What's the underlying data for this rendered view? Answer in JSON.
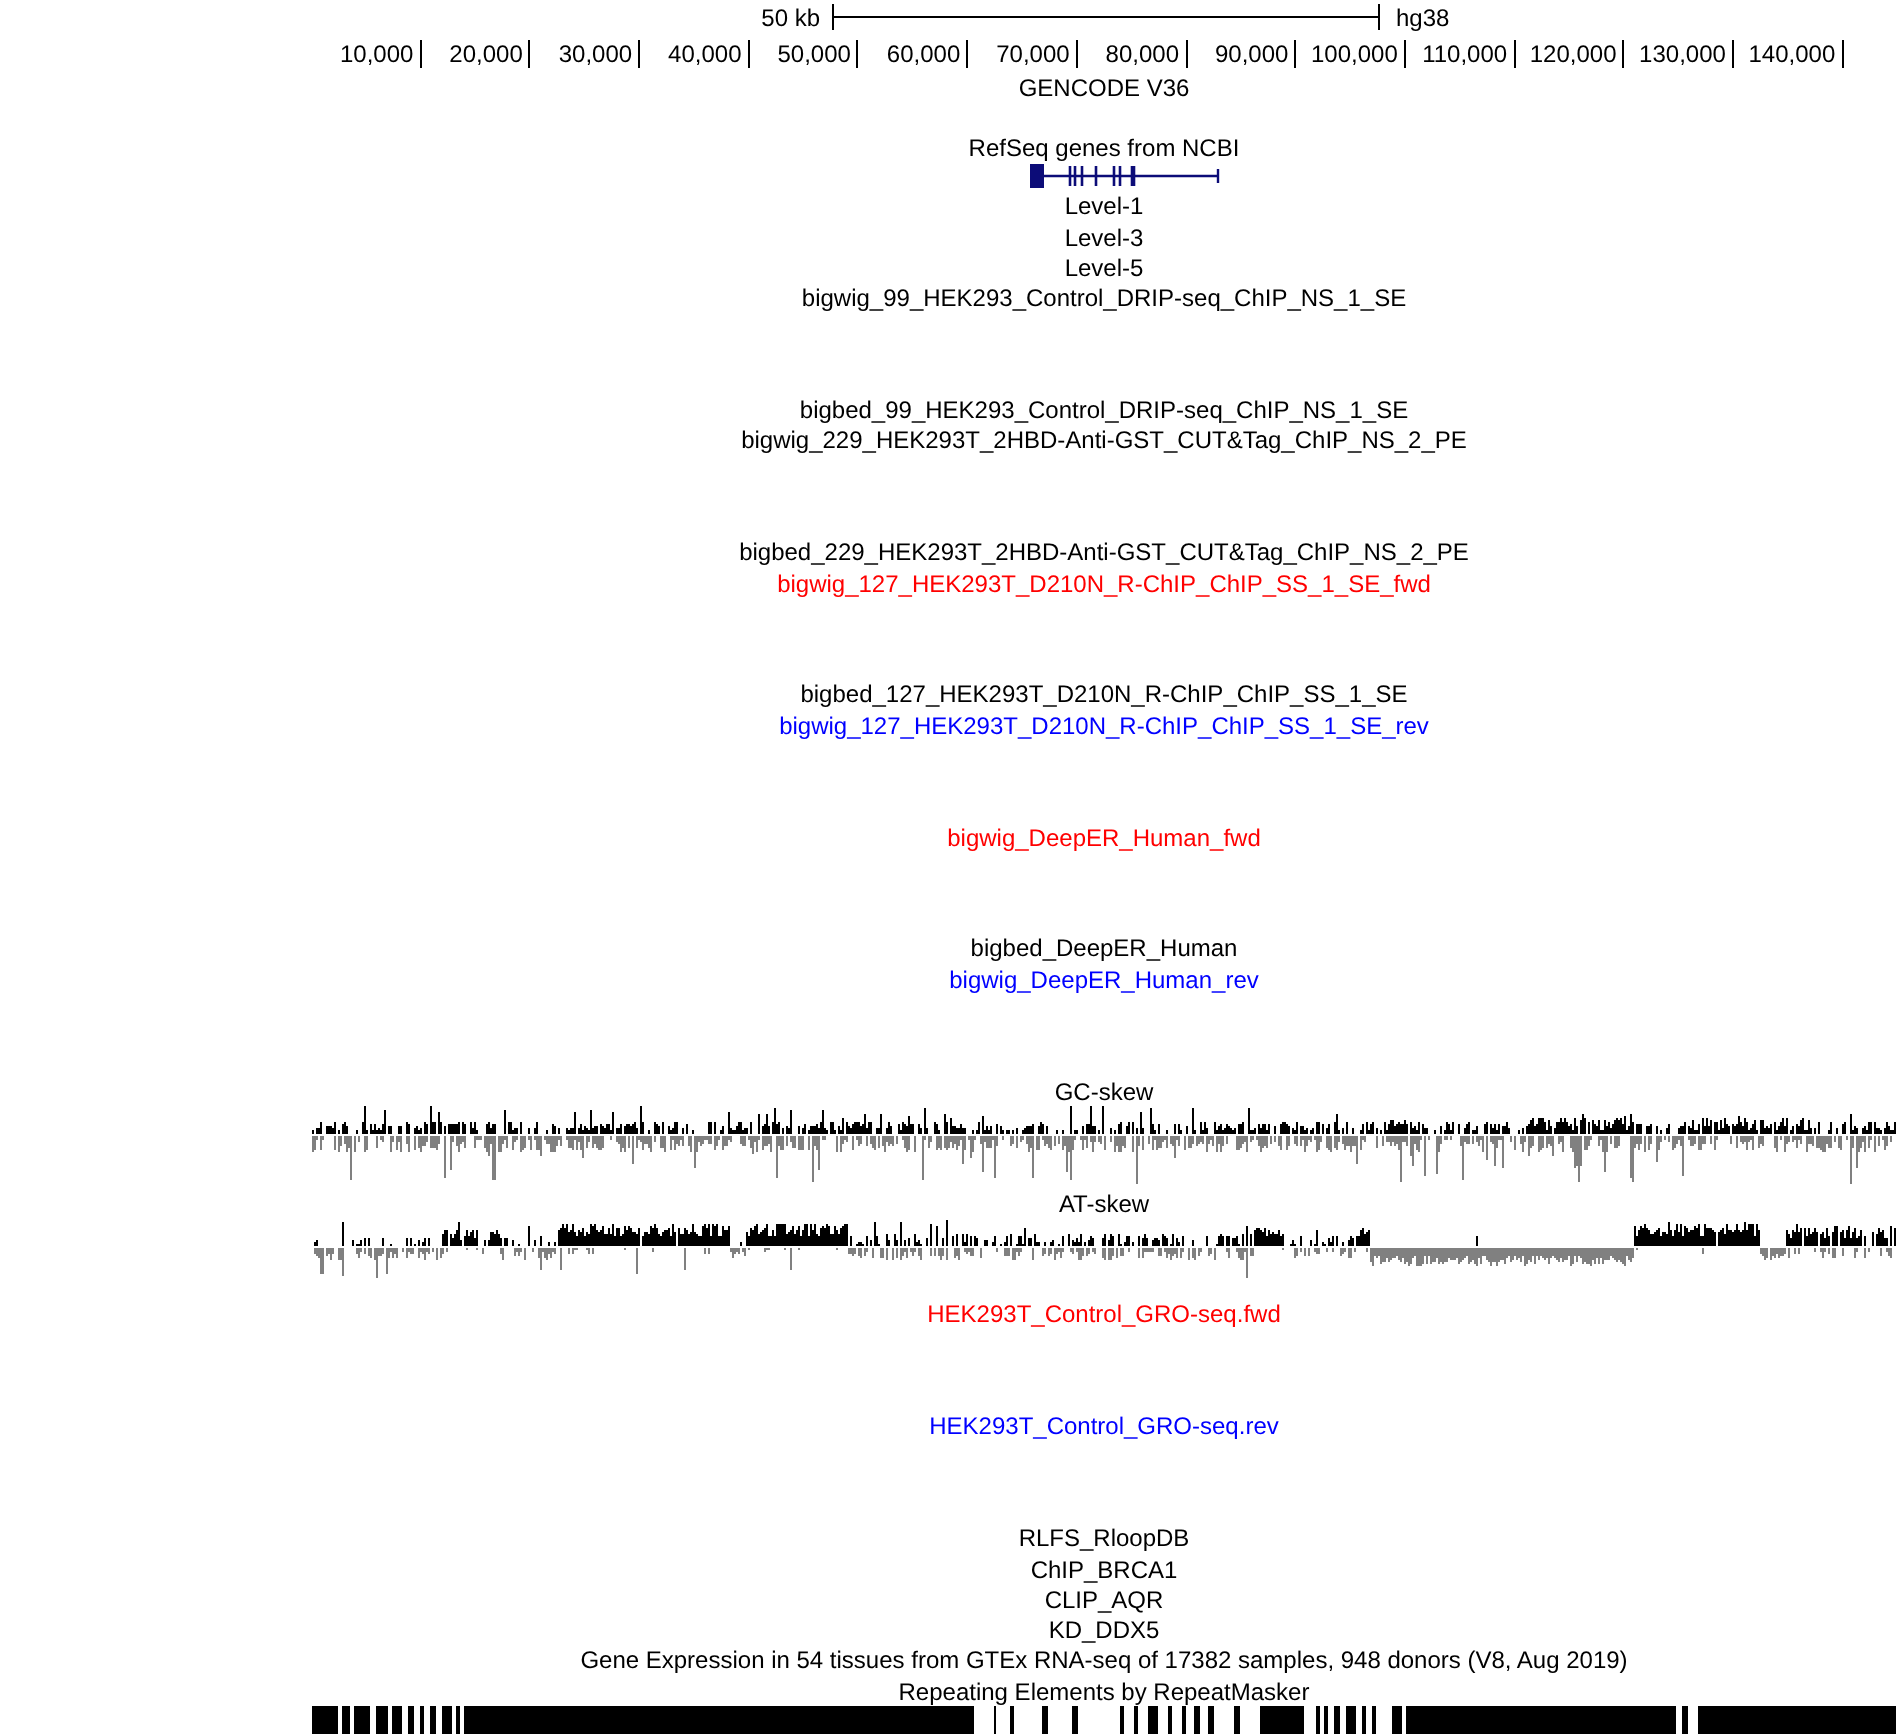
{
  "scale_bar": {
    "label": "50 kb",
    "assembly": "hg38"
  },
  "ruler": {
    "ticks": [
      "10,000",
      "20,000",
      "30,000",
      "40,000",
      "50,000",
      "60,000",
      "70,000",
      "80,000",
      "90,000",
      "100,000",
      "110,000",
      "120,000",
      "130,000",
      "140,000"
    ]
  },
  "tracks": [
    {
      "kind": "blank",
      "label": "GENCODE V36",
      "color": "#000000"
    },
    {
      "kind": "gene",
      "label": "RefSeq genes from NCBI",
      "color": "#000000"
    },
    {
      "kind": "label",
      "label": "Level-1",
      "color": "#000000"
    },
    {
      "kind": "label",
      "label": "Level-3",
      "color": "#000000"
    },
    {
      "kind": "label",
      "label": "Level-5",
      "color": "#000000"
    },
    {
      "kind": "signal",
      "label": "bigwig_99_HEK293_Control_DRIP-seq_ChIP_NS_1_SE",
      "color": "#000000"
    },
    {
      "kind": "label",
      "label": "bigbed_99_HEK293_Control_DRIP-seq_ChIP_NS_1_SE",
      "color": "#000000"
    },
    {
      "kind": "signal",
      "label": "bigwig_229_HEK293T_2HBD-Anti-GST_CUT&Tag_ChIP_NS_2_PE",
      "color": "#000000"
    },
    {
      "kind": "label",
      "label": "bigbed_229_HEK293T_2HBD-Anti-GST_CUT&Tag_ChIP_NS_2_PE",
      "color": "#000000"
    },
    {
      "kind": "signal",
      "label": "bigwig_127_HEK293T_D210N_R-ChIP_ChIP_SS_1_SE_fwd",
      "color": "#ff0000"
    },
    {
      "kind": "label",
      "label": "bigbed_127_HEK293T_D210N_R-ChIP_ChIP_SS_1_SE",
      "color": "#000000"
    },
    {
      "kind": "signal",
      "label": "bigwig_127_HEK293T_D210N_R-ChIP_ChIP_SS_1_SE_rev",
      "color": "#0000ff"
    },
    {
      "kind": "signal",
      "label": "bigwig_DeepER_Human_fwd",
      "color": "#ff0000"
    },
    {
      "kind": "label",
      "label": "bigbed_DeepER_Human",
      "color": "#000000"
    },
    {
      "kind": "signal",
      "label": "bigwig_DeepER_Human_rev",
      "color": "#0000ff"
    },
    {
      "kind": "skew",
      "label": "GC-skew",
      "color": "#000000"
    },
    {
      "kind": "skew",
      "label": "AT-skew",
      "color": "#000000"
    },
    {
      "kind": "signal",
      "label": "HEK293T_Control_GRO-seq.fwd",
      "color": "#ff0000"
    },
    {
      "kind": "signal",
      "label": "HEK293T_Control_GRO-seq.rev",
      "color": "#0000ff"
    },
    {
      "kind": "label",
      "label": "RLFS_RloopDB",
      "color": "#000000"
    },
    {
      "kind": "label",
      "label": "ChIP_BRCA1",
      "color": "#000000"
    },
    {
      "kind": "label",
      "label": "CLIP_AQR",
      "color": "#000000"
    },
    {
      "kind": "label",
      "label": "KD_DDX5",
      "color": "#000000"
    },
    {
      "kind": "label",
      "label": "Gene Expression in 54 tissues from GTEx RNA-seq of 17382 samples, 948 donors (V8, Aug 2019)",
      "color": "#000000"
    },
    {
      "kind": "repeat",
      "label": "Repeating Elements by RepeatMasker",
      "color": "#000000"
    }
  ]
}
